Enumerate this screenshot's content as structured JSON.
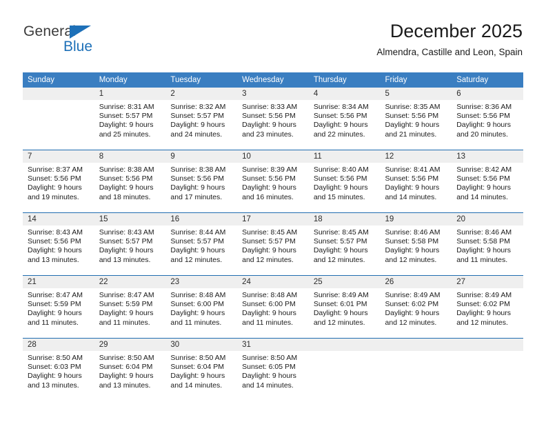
{
  "brand": {
    "name_part1": "General",
    "name_part2": "Blue",
    "triangle_color": "#1d70b8"
  },
  "header": {
    "title": "December 2025",
    "subtitle": "Almendra, Castille and Leon, Spain"
  },
  "colors": {
    "header_row_bg": "#3a7ec1",
    "header_row_text": "#ffffff",
    "week_divider": "#1f6cb0",
    "daynum_band": "#efefef",
    "page_bg": "#ffffff"
  },
  "weekday_headers": [
    "Sunday",
    "Monday",
    "Tuesday",
    "Wednesday",
    "Thursday",
    "Friday",
    "Saturday"
  ],
  "labels": {
    "sunrise_prefix": "Sunrise:",
    "sunset_prefix": "Sunset:",
    "daylight_prefix": "Daylight:"
  },
  "weeks": [
    [
      {
        "day": "",
        "sunrise": "",
        "sunset": "",
        "daylight_line1": "",
        "daylight_line2": ""
      },
      {
        "day": "1",
        "sunrise": "Sunrise: 8:31 AM",
        "sunset": "Sunset: 5:57 PM",
        "daylight_line1": "Daylight: 9 hours",
        "daylight_line2": "and 25 minutes."
      },
      {
        "day": "2",
        "sunrise": "Sunrise: 8:32 AM",
        "sunset": "Sunset: 5:57 PM",
        "daylight_line1": "Daylight: 9 hours",
        "daylight_line2": "and 24 minutes."
      },
      {
        "day": "3",
        "sunrise": "Sunrise: 8:33 AM",
        "sunset": "Sunset: 5:56 PM",
        "daylight_line1": "Daylight: 9 hours",
        "daylight_line2": "and 23 minutes."
      },
      {
        "day": "4",
        "sunrise": "Sunrise: 8:34 AM",
        "sunset": "Sunset: 5:56 PM",
        "daylight_line1": "Daylight: 9 hours",
        "daylight_line2": "and 22 minutes."
      },
      {
        "day": "5",
        "sunrise": "Sunrise: 8:35 AM",
        "sunset": "Sunset: 5:56 PM",
        "daylight_line1": "Daylight: 9 hours",
        "daylight_line2": "and 21 minutes."
      },
      {
        "day": "6",
        "sunrise": "Sunrise: 8:36 AM",
        "sunset": "Sunset: 5:56 PM",
        "daylight_line1": "Daylight: 9 hours",
        "daylight_line2": "and 20 minutes."
      }
    ],
    [
      {
        "day": "7",
        "sunrise": "Sunrise: 8:37 AM",
        "sunset": "Sunset: 5:56 PM",
        "daylight_line1": "Daylight: 9 hours",
        "daylight_line2": "and 19 minutes."
      },
      {
        "day": "8",
        "sunrise": "Sunrise: 8:38 AM",
        "sunset": "Sunset: 5:56 PM",
        "daylight_line1": "Daylight: 9 hours",
        "daylight_line2": "and 18 minutes."
      },
      {
        "day": "9",
        "sunrise": "Sunrise: 8:38 AM",
        "sunset": "Sunset: 5:56 PM",
        "daylight_line1": "Daylight: 9 hours",
        "daylight_line2": "and 17 minutes."
      },
      {
        "day": "10",
        "sunrise": "Sunrise: 8:39 AM",
        "sunset": "Sunset: 5:56 PM",
        "daylight_line1": "Daylight: 9 hours",
        "daylight_line2": "and 16 minutes."
      },
      {
        "day": "11",
        "sunrise": "Sunrise: 8:40 AM",
        "sunset": "Sunset: 5:56 PM",
        "daylight_line1": "Daylight: 9 hours",
        "daylight_line2": "and 15 minutes."
      },
      {
        "day": "12",
        "sunrise": "Sunrise: 8:41 AM",
        "sunset": "Sunset: 5:56 PM",
        "daylight_line1": "Daylight: 9 hours",
        "daylight_line2": "and 14 minutes."
      },
      {
        "day": "13",
        "sunrise": "Sunrise: 8:42 AM",
        "sunset": "Sunset: 5:56 PM",
        "daylight_line1": "Daylight: 9 hours",
        "daylight_line2": "and 14 minutes."
      }
    ],
    [
      {
        "day": "14",
        "sunrise": "Sunrise: 8:43 AM",
        "sunset": "Sunset: 5:56 PM",
        "daylight_line1": "Daylight: 9 hours",
        "daylight_line2": "and 13 minutes."
      },
      {
        "day": "15",
        "sunrise": "Sunrise: 8:43 AM",
        "sunset": "Sunset: 5:57 PM",
        "daylight_line1": "Daylight: 9 hours",
        "daylight_line2": "and 13 minutes."
      },
      {
        "day": "16",
        "sunrise": "Sunrise: 8:44 AM",
        "sunset": "Sunset: 5:57 PM",
        "daylight_line1": "Daylight: 9 hours",
        "daylight_line2": "and 12 minutes."
      },
      {
        "day": "17",
        "sunrise": "Sunrise: 8:45 AM",
        "sunset": "Sunset: 5:57 PM",
        "daylight_line1": "Daylight: 9 hours",
        "daylight_line2": "and 12 minutes."
      },
      {
        "day": "18",
        "sunrise": "Sunrise: 8:45 AM",
        "sunset": "Sunset: 5:57 PM",
        "daylight_line1": "Daylight: 9 hours",
        "daylight_line2": "and 12 minutes."
      },
      {
        "day": "19",
        "sunrise": "Sunrise: 8:46 AM",
        "sunset": "Sunset: 5:58 PM",
        "daylight_line1": "Daylight: 9 hours",
        "daylight_line2": "and 12 minutes."
      },
      {
        "day": "20",
        "sunrise": "Sunrise: 8:46 AM",
        "sunset": "Sunset: 5:58 PM",
        "daylight_line1": "Daylight: 9 hours",
        "daylight_line2": "and 11 minutes."
      }
    ],
    [
      {
        "day": "21",
        "sunrise": "Sunrise: 8:47 AM",
        "sunset": "Sunset: 5:59 PM",
        "daylight_line1": "Daylight: 9 hours",
        "daylight_line2": "and 11 minutes."
      },
      {
        "day": "22",
        "sunrise": "Sunrise: 8:47 AM",
        "sunset": "Sunset: 5:59 PM",
        "daylight_line1": "Daylight: 9 hours",
        "daylight_line2": "and 11 minutes."
      },
      {
        "day": "23",
        "sunrise": "Sunrise: 8:48 AM",
        "sunset": "Sunset: 6:00 PM",
        "daylight_line1": "Daylight: 9 hours",
        "daylight_line2": "and 11 minutes."
      },
      {
        "day": "24",
        "sunrise": "Sunrise: 8:48 AM",
        "sunset": "Sunset: 6:00 PM",
        "daylight_line1": "Daylight: 9 hours",
        "daylight_line2": "and 11 minutes."
      },
      {
        "day": "25",
        "sunrise": "Sunrise: 8:49 AM",
        "sunset": "Sunset: 6:01 PM",
        "daylight_line1": "Daylight: 9 hours",
        "daylight_line2": "and 12 minutes."
      },
      {
        "day": "26",
        "sunrise": "Sunrise: 8:49 AM",
        "sunset": "Sunset: 6:02 PM",
        "daylight_line1": "Daylight: 9 hours",
        "daylight_line2": "and 12 minutes."
      },
      {
        "day": "27",
        "sunrise": "Sunrise: 8:49 AM",
        "sunset": "Sunset: 6:02 PM",
        "daylight_line1": "Daylight: 9 hours",
        "daylight_line2": "and 12 minutes."
      }
    ],
    [
      {
        "day": "28",
        "sunrise": "Sunrise: 8:50 AM",
        "sunset": "Sunset: 6:03 PM",
        "daylight_line1": "Daylight: 9 hours",
        "daylight_line2": "and 13 minutes."
      },
      {
        "day": "29",
        "sunrise": "Sunrise: 8:50 AM",
        "sunset": "Sunset: 6:04 PM",
        "daylight_line1": "Daylight: 9 hours",
        "daylight_line2": "and 13 minutes."
      },
      {
        "day": "30",
        "sunrise": "Sunrise: 8:50 AM",
        "sunset": "Sunset: 6:04 PM",
        "daylight_line1": "Daylight: 9 hours",
        "daylight_line2": "and 14 minutes."
      },
      {
        "day": "31",
        "sunrise": "Sunrise: 8:50 AM",
        "sunset": "Sunset: 6:05 PM",
        "daylight_line1": "Daylight: 9 hours",
        "daylight_line2": "and 14 minutes."
      },
      {
        "day": "",
        "sunrise": "",
        "sunset": "",
        "daylight_line1": "",
        "daylight_line2": ""
      },
      {
        "day": "",
        "sunrise": "",
        "sunset": "",
        "daylight_line1": "",
        "daylight_line2": ""
      },
      {
        "day": "",
        "sunrise": "",
        "sunset": "",
        "daylight_line1": "",
        "daylight_line2": ""
      }
    ]
  ]
}
